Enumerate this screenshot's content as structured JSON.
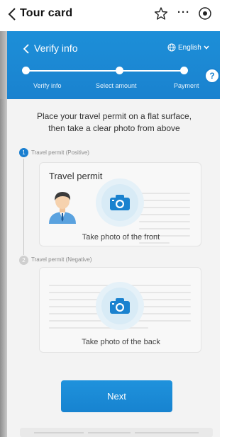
{
  "topbar": {
    "title": "Tour card",
    "more": "···"
  },
  "header": {
    "title": "Verify info",
    "language": "English",
    "steps": [
      "Verify info",
      "Select amount",
      "Payment"
    ],
    "help": "?"
  },
  "instruction": {
    "line1": "Place your travel permit on a flat surface,",
    "line2": "then take a clear photo from above"
  },
  "front": {
    "step": "1",
    "label": "Travel permit (Positive)",
    "card_title": "Travel permit",
    "caption": "Take photo of the front"
  },
  "back": {
    "step": "2",
    "label": "Travel permit (Negative)",
    "caption": "Take photo of the back"
  },
  "next_label": "Next",
  "colors": {
    "primary": "#1a82cf",
    "background": "#f3f3f3"
  }
}
